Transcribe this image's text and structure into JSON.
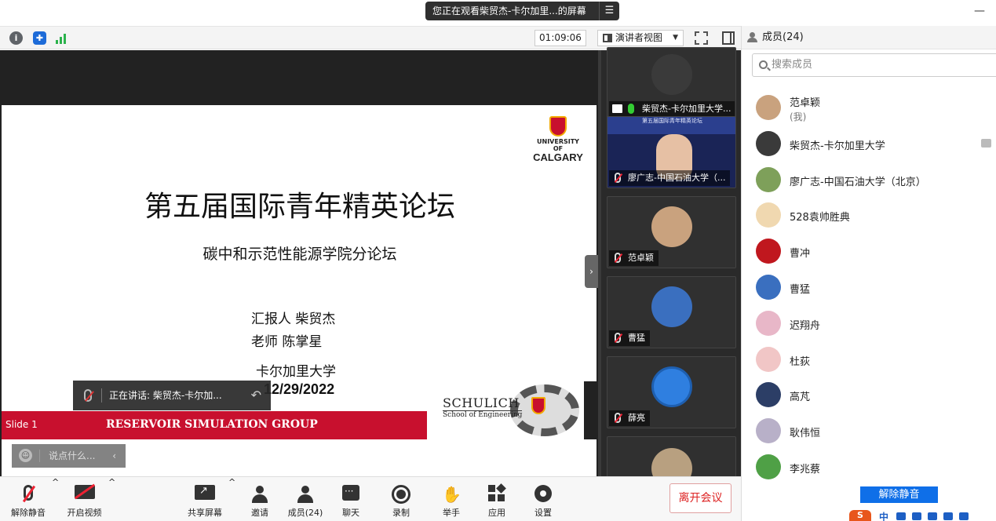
{
  "titlebar": {
    "share_banner": "您正在观看柴贸杰-卡尔加里...的屏幕",
    "banner_menu_icon": "list-menu-icon",
    "minimize_glyph": "—"
  },
  "toolbar": {
    "timer": "01:09:06",
    "view_mode": "演讲者视图",
    "view_arrow": "▼",
    "signal_color": "#2bb24c"
  },
  "slide": {
    "title": "第五届国际青年精英论坛",
    "subtitle": "碳中和示范性能源学院分论坛",
    "presenter": "汇报人  柴贸杰",
    "advisor": "老师  陈掌星",
    "university": "卡尔加里大学",
    "date": "12/29/2022",
    "logo_university": "UNIVERSITY OF",
    "logo_name": "CALGARY",
    "slide_number": "Slide 1",
    "group": "RESERVOIR SIMULATION GROUP",
    "schulich_name": "SCHULICH",
    "schulich_sub": "School of Engineering",
    "banner_color": "#c8102e"
  },
  "overlays": {
    "speaking": "正在讲话: 柴贸杰-卡尔加...",
    "chat_placeholder": "说点什么...",
    "chat_emoji": "☺",
    "chat_collapse": "‹",
    "reply_glyph": "↶",
    "gallery_toggle": "›"
  },
  "gallery": {
    "tiles": [
      {
        "label": "柴贸杰-卡尔加里大学..."
      },
      {
        "label": "廖广志-中国石油大学（..."
      },
      {
        "label": "范卓颖"
      },
      {
        "label": "曹猛"
      },
      {
        "label": "薛亮"
      },
      {
        "label": ""
      }
    ],
    "tile2_banner": "第五届国际青年精英论坛"
  },
  "members": {
    "header": "成员(24)",
    "search_placeholder": "搜索成员",
    "list": [
      {
        "name": "范卓颖",
        "sub": "(我)",
        "color": "#c9a27e"
      },
      {
        "name": "柴贸杰-卡尔加里大学",
        "sub": "",
        "color": "#3a3a3a"
      },
      {
        "name": "廖广志-中国石油大学（北京）",
        "sub": "",
        "color": "#7ea05a"
      },
      {
        "name": "528袁帅胜典",
        "sub": "",
        "color": "#f0d8b0"
      },
      {
        "name": "曹冲",
        "sub": "",
        "color": "#c0171e"
      },
      {
        "name": "曹猛",
        "sub": "",
        "color": "#3a6fbf"
      },
      {
        "name": "迟翔舟",
        "sub": "",
        "color": "#e8b7c8"
      },
      {
        "name": "杜荻",
        "sub": "",
        "color": "#f1c6c6"
      },
      {
        "name": "高芃",
        "sub": "",
        "color": "#2c3e66"
      },
      {
        "name": "耿伟恒",
        "sub": "",
        "color": "#b8b0c8"
      },
      {
        "name": "李兆蔡",
        "sub": "",
        "color": "#4fa046"
      }
    ],
    "unmute_all": "解除静音"
  },
  "bottombar": {
    "mute": "解除静音",
    "video": "开启视频",
    "share": "共享屏幕",
    "invite": "邀请",
    "members": "成员(24)",
    "chat": "聊天",
    "record": "录制",
    "raise_hand": "举手",
    "apps": "应用",
    "settings": "设置",
    "leave": "离开会议",
    "caret": "^",
    "hand_glyph": "✋"
  },
  "ime": {
    "logo": "S",
    "lang": "中"
  }
}
